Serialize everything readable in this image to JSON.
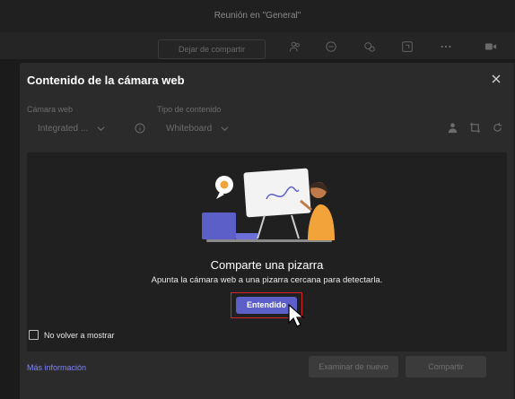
{
  "window": {
    "title": "Reunión en \"General\""
  },
  "toolbar": {
    "share_label": "Dejar de compartir",
    "icons": [
      "people-icon",
      "chat-icon",
      "react-icon",
      "rooms-icon",
      "more-icon",
      "camera-icon"
    ]
  },
  "dialog": {
    "title": "Contenido de la cámara web",
    "camera_label": "Cámara web",
    "camera_value": "Integrated ...",
    "content_type_label": "Tipo de contenido",
    "content_type_value": "Whiteboard",
    "message_title": "Comparte una pizarra",
    "message_subtitle": "Apunta la cámara web a una pizarra cercana para detectarla.",
    "primary_button": "Entendido",
    "checkbox_label": "No volver a mostrar",
    "link_label": "Más información",
    "retry_button": "Examinar de nuevo",
    "share_button": "Compartir"
  },
  "colors": {
    "accent": "#5b5fc7",
    "link": "#7f85f5",
    "highlight": "#d7262b",
    "dialog_bg": "#2b2b2b"
  }
}
